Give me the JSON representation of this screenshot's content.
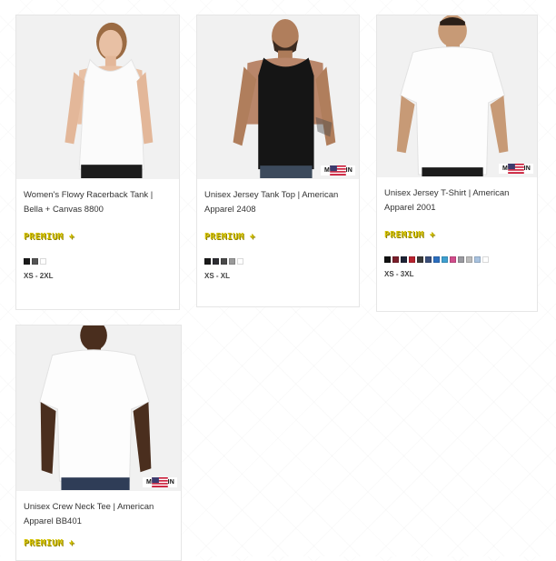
{
  "products": [
    {
      "title": "Women's Flowy Racerback Tank | Bella + Canvas 8800",
      "badge": "PREMIUM +",
      "made_in": "",
      "sizes": "XS - 2XL",
      "swatches": [
        "#1a1a1a",
        "#555555",
        "#ffffff"
      ]
    },
    {
      "title": "Unisex Jersey Tank Top | American Apparel 2408",
      "badge": "PREMIUM +",
      "made_in": "MADE IN",
      "sizes": "XS - XL",
      "swatches": [
        "#1a1a1a",
        "#2e2e33",
        "#4a4a4a",
        "#9a9a9a",
        "#ffffff"
      ]
    },
    {
      "title": "Unisex Jersey T-Shirt | American Apparel 2001",
      "badge": "PREMIUM +",
      "made_in": "MADE IN",
      "sizes": "XS - 3XL",
      "swatches": [
        "#111111",
        "#7a1f2b",
        "#1f2436",
        "#b8232f",
        "#3a3a3a",
        "#3b4f7a",
        "#2c6fbf",
        "#3fa0d0",
        "#d24d8c",
        "#9a9aa0",
        "#bcbcbc",
        "#a9c3e0",
        "#ffffff"
      ]
    },
    {
      "title": "Unisex Crew Neck Tee | American Apparel BB401",
      "badge": "PREMIUM +",
      "made_in": "MADE IN",
      "sizes": "",
      "swatches": []
    }
  ]
}
